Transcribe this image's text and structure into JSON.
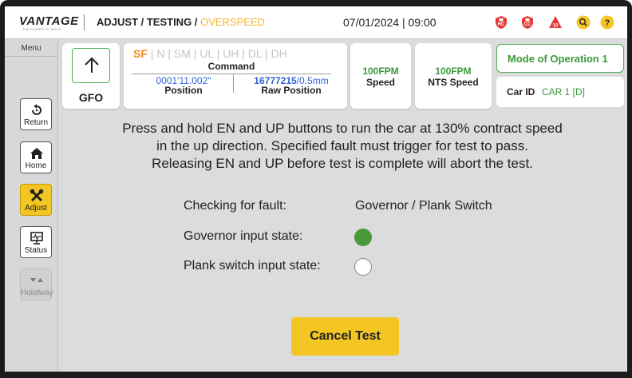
{
  "header": {
    "logo": "VANTAGE",
    "logo_tagline": "THE POWER TO MOVE",
    "breadcrumb_prefix": "ADJUST / TESTING / ",
    "breadcrumb_active": "OVERSPEED",
    "datetime": "07/01/2024  |  09:00",
    "alerts": [
      {
        "icon": "hoistway-access-badge-icon",
        "text": "HC",
        "color": "#e53935"
      },
      {
        "icon": "car-access-badge-icon",
        "text": "CC",
        "color": "#e53935"
      },
      {
        "icon": "fault-warning-icon",
        "text": "10",
        "color": "#e53935"
      },
      {
        "icon": "search-icon",
        "color": "#f3c623"
      },
      {
        "icon": "help-icon",
        "text": "?",
        "color": "#f3c623"
      }
    ]
  },
  "sidebar": {
    "menu_label": "Menu",
    "items": [
      {
        "icon": "return-icon",
        "label": "Return"
      },
      {
        "icon": "home-icon",
        "label": "Home"
      },
      {
        "icon": "adjust-tools-icon",
        "label": "Adjust",
        "active": true
      },
      {
        "icon": "status-monitor-icon",
        "label": "Status"
      },
      {
        "icon": "hoistway-icon",
        "label": "Hoistway",
        "disabled": true
      }
    ]
  },
  "status": {
    "gfo": {
      "icon": "up-arrow-icon",
      "label": "GFO"
    },
    "command": {
      "flags": [
        {
          "text": "SF",
          "active": true
        },
        {
          "text": "N",
          "active": false
        },
        {
          "text": "SM",
          "active": false
        },
        {
          "text": "UL",
          "active": false
        },
        {
          "text": "UH",
          "active": false
        },
        {
          "text": "DL",
          "active": false
        },
        {
          "text": "DH",
          "active": false
        }
      ],
      "title": "Command",
      "position_value": "0001'11.002\"",
      "position_label": "Position",
      "raw_position_bold": "16777215",
      "raw_position_rest": "/0.5mm",
      "raw_position_label": "Raw Position"
    },
    "speed": {
      "value": "100FPM",
      "label": "Speed"
    },
    "nts_speed": {
      "value": "100FPM",
      "label": "NTS Speed"
    },
    "mode": "Mode of Operation 1",
    "car_id_label": "Car ID",
    "car_id_value": "CAR 1 [D]"
  },
  "test": {
    "instructions": [
      "Press and hold EN and UP buttons to run the car at 130% contract speed",
      "in the up direction. Specified fault must trigger for test to pass.",
      "Releasing EN and UP before test is complete will abort the test."
    ],
    "checking_label": "Checking for fault:",
    "checking_value": "Governor / Plank Switch",
    "governor_label": "Governor input state:",
    "governor_active": true,
    "plank_label": "Plank switch input state:",
    "plank_active": false,
    "cancel_label": "Cancel Test"
  },
  "colors": {
    "accent_yellow": "#f3c623",
    "active_green": "#4a9a3a",
    "orange": "#ef8a1f",
    "blue": "#2e64d8",
    "alert_red": "#e53935"
  }
}
